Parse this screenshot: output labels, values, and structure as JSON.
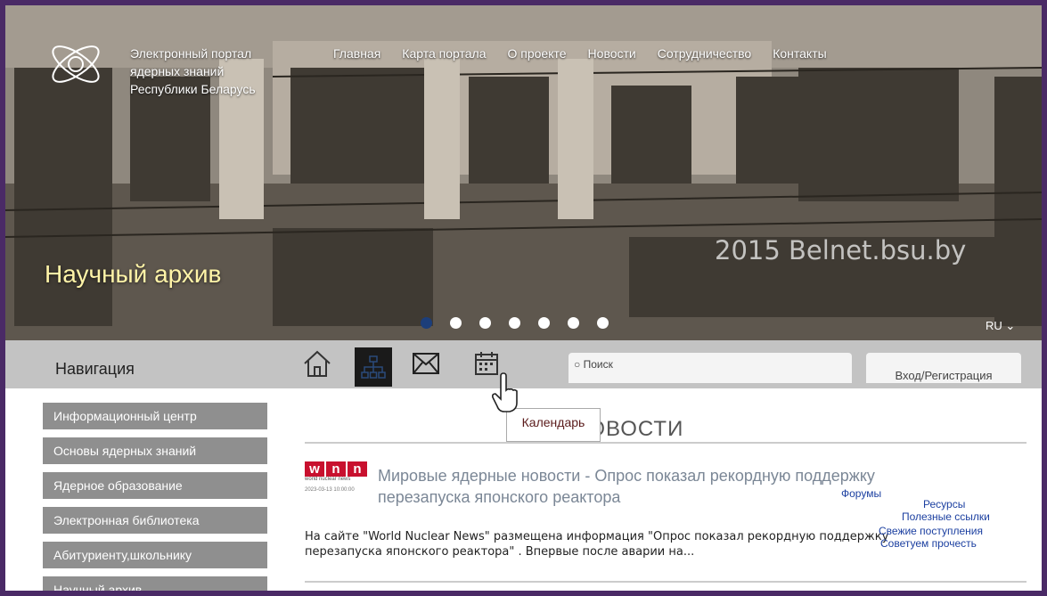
{
  "header": {
    "logo_lines": [
      "Электронный портал",
      "ядерных знаний",
      "Республики Беларусь"
    ],
    "nav": [
      "Главная",
      "Карта портала",
      "О проекте",
      "Новости",
      "Сотрудничество",
      "Контакты"
    ]
  },
  "hero": {
    "caption": "Научный архив",
    "watermark": "2015 Belnet.bsu.by",
    "lang": "RU",
    "slides_total": 7,
    "active_slide": 1
  },
  "toolbar": {
    "nav_title": "Навигация",
    "search_placeholder": "Поиск",
    "login_label": "Вход/Регистрация",
    "icons": [
      "home-icon",
      "sitemap-icon",
      "mail-icon",
      "calendar-icon"
    ],
    "tooltip": "Календарь"
  },
  "menu": [
    "Информационный центр",
    "Основы ядерных знаний",
    "Ядерное образование",
    "Электронная библиотека",
    "Абитуриенту,школьнику",
    "Научный архив"
  ],
  "news": {
    "section_title": "НОВОСТИ",
    "source_logo": "wnn",
    "source_tagline": "world nuclear news",
    "date": "2023-03-13 10:00:00",
    "title_line1": "Мировые ядерные новости - Опрос показал рекордную поддержку",
    "title_line2": "перезапуска японского реактора",
    "body_line1": "На сайте \"World Nuclear News\" размещена информация \"Опрос показал рекордную поддержку",
    "body_line2": "перезапуска японского реактора\" . Впервые после аварии на..."
  },
  "floating_links": [
    "Форумы",
    "Ресурсы",
    "Полезные ссылки",
    "Свежие поступления",
    "Советуем прочесть"
  ]
}
